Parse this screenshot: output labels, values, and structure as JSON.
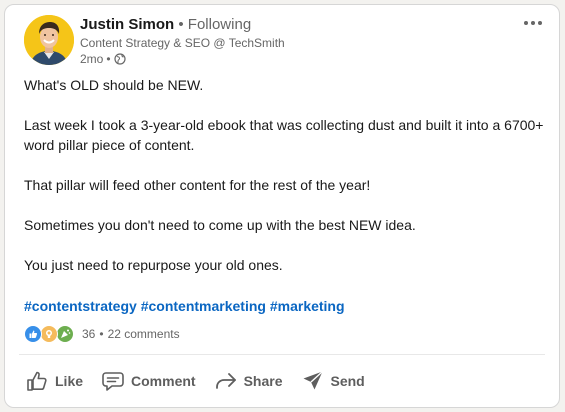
{
  "author": {
    "name": "Justin Simon",
    "separator": "•",
    "follow_status": "Following",
    "headline": "Content Strategy & SEO @ TechSmith",
    "time": "2mo",
    "time_separator": "•",
    "visibility_icon": "globe-icon",
    "avatar_bg": "#f5c518"
  },
  "menu": {
    "icon": "more-options-icon"
  },
  "post": {
    "paragraphs": [
      "What's OLD should be NEW.",
      "Last week I took a 3-year-old ebook that was collecting dust and built it into a 6700+ word pillar piece of content.",
      "That pillar will feed other content for the rest of the year!",
      "Sometimes you don't need to come up with the best NEW idea.",
      "You just need to repurpose your old ones."
    ],
    "hashtags": [
      "#contentstrategy",
      "#contentmarketing",
      "#marketing"
    ]
  },
  "social": {
    "reaction_icons": [
      "like-reaction-icon",
      "insightful-reaction-icon",
      "celebrate-reaction-icon"
    ],
    "reaction_count": "36",
    "separator": "•",
    "comments": "22 comments"
  },
  "actions": [
    {
      "label": "Like",
      "icon": "thumbs-up-icon"
    },
    {
      "label": "Comment",
      "icon": "comment-icon"
    },
    {
      "label": "Share",
      "icon": "share-arrow-icon"
    },
    {
      "label": "Send",
      "icon": "send-icon"
    }
  ],
  "colors": {
    "link": "#0a66c2",
    "text": "#191919",
    "muted": "#666666",
    "like_blue": "#378fe9",
    "insightful_yellow": "#f5bb5c",
    "celebrate_green": "#6dae4f"
  }
}
